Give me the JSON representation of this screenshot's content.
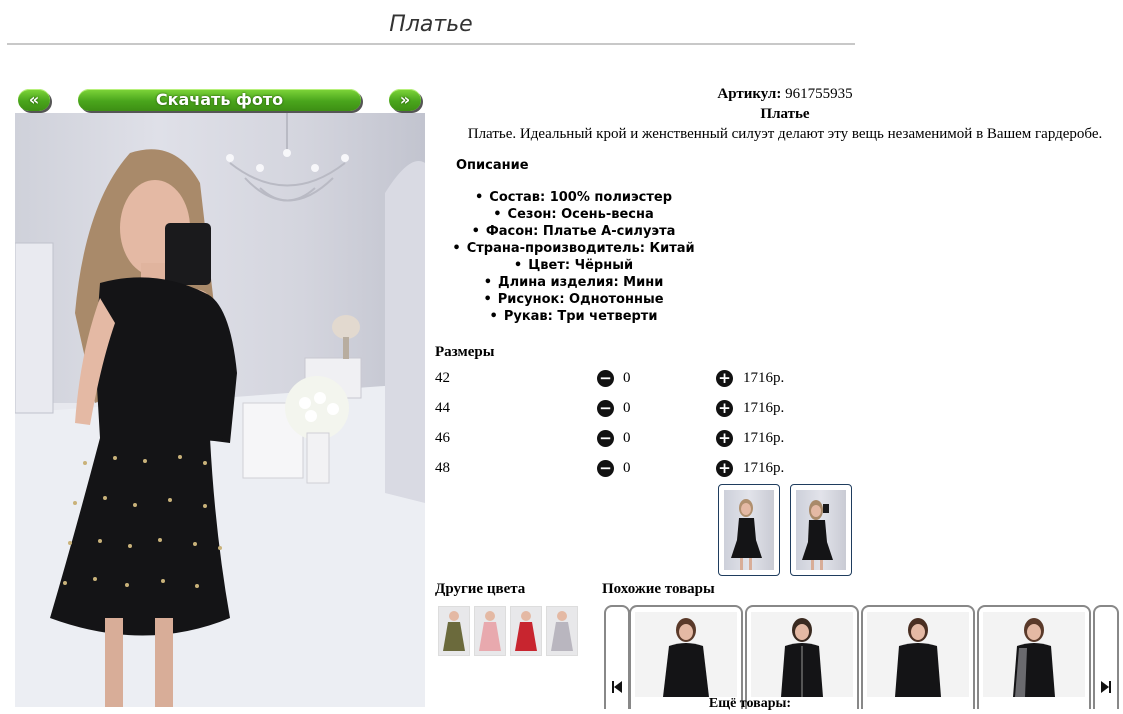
{
  "page": {
    "title": "Платье"
  },
  "gallery": {
    "prev_label": "«",
    "download_label": "Скачать фото",
    "next_label": "»"
  },
  "product": {
    "sku_label": "Артикул:",
    "sku_value": "961755935",
    "name": "Платье",
    "description": "Платье. Идеальный крой и женственный силуэт делают эту вещь незаменимой в Вашем гардеробе."
  },
  "description_heading": "Описание",
  "specs": [
    "Состав: 100% полиэстер",
    "Сезон: Осень-весна",
    "Фасон: Платье А-силуэта",
    "Страна-производитель: Китай",
    "Цвет: Чёрный",
    "Длина изделия: Мини",
    "Рисунок: Однотонные",
    "Рукав: Три четверти"
  ],
  "sizes": {
    "heading": "Размеры",
    "rows": [
      {
        "size": "42",
        "qty": "0",
        "price": "1716р."
      },
      {
        "size": "44",
        "qty": "0",
        "price": "1716р."
      },
      {
        "size": "46",
        "qty": "0",
        "price": "1716р."
      },
      {
        "size": "48",
        "qty": "0",
        "price": "1716р."
      }
    ],
    "minus_icon": "⊖",
    "plus_icon": "⊕"
  },
  "other_colors": {
    "heading": "Другие цвета",
    "dress_colors": [
      "#6b6a3c",
      "#e8a9ae",
      "#c8252f",
      "#b9b6bf"
    ]
  },
  "similar": {
    "heading": "Похожие товары",
    "more_label": "Ещё товары:"
  },
  "colors": {
    "accent_green": "#4aa51c",
    "dress": "#111111"
  }
}
